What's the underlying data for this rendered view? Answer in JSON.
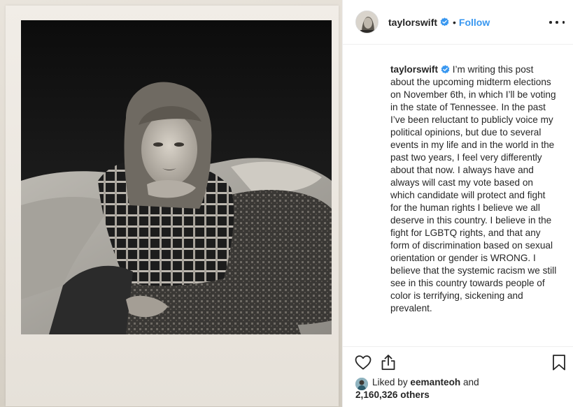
{
  "header": {
    "username": "taylorswift",
    "separator": "•",
    "follow_label": "Follow",
    "more_icon": "more-options-icon",
    "verified_icon": "verified-badge-icon"
  },
  "caption": {
    "username": "taylorswift",
    "text": " I’m writing this post about the upcoming midterm elections on November 6th, in which I’ll be voting in the state of Tennessee. In the past I’ve been reluctant to publicly voice my political opinions, but due to several events in my life and in the world in the past two years, I feel very differently about that now. I always have and always will cast my vote based on which candidate will protect and fight for the human rights I believe we all deserve in this country. I believe in the fight for LGBTQ rights, and that any form of discrimination based on sexual orientation or gender is WRONG. I believe that the systemic racism we still see in this country towards people of color is terrifying, sickening and prevalent."
  },
  "actions": {
    "like_icon": "heart-icon",
    "share_icon": "share-icon",
    "save_icon": "bookmark-icon"
  },
  "likes": {
    "prefix": "Liked by ",
    "liker": "eemanteoh",
    "connector": " and",
    "count": "2,160,326 others"
  },
  "colors": {
    "accent": "#3897f0",
    "text": "#262626",
    "border": "#efefef"
  }
}
